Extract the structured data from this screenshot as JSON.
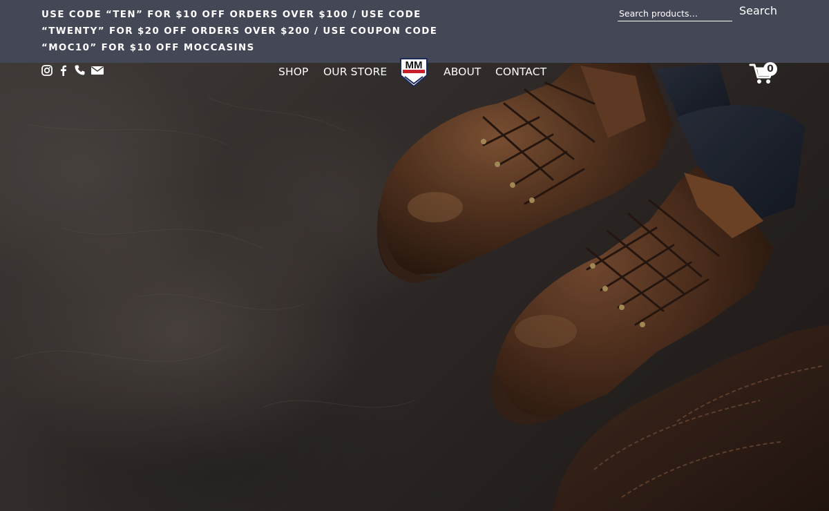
{
  "topbar": {
    "promo_text": "USE CODE “TEN” FOR $10 OFF ORDERS OVER $100 / USE CODE “TWENTY” FOR $20 OFF ORDERS OVER $200 / USE COUPON CODE “MOC10” FOR $10 OFF MOCCASINS",
    "search_placeholder": "Search products…",
    "search_label": "Search",
    "background_color": "#444755"
  },
  "header": {
    "social_icons": [
      "instagram-icon",
      "facebook-icon",
      "phone-icon",
      "mail-icon"
    ],
    "nav_left": [
      {
        "label": "SHOP"
      },
      {
        "label": "OUR STORE"
      }
    ],
    "nav_right": [
      {
        "label": "ABOUT"
      },
      {
        "label": "CONTACT"
      }
    ],
    "logo_text": "MM",
    "cart_count": "0"
  },
  "hero": {
    "image": "brown leather work boots and leather gloves on dark textured surface"
  }
}
